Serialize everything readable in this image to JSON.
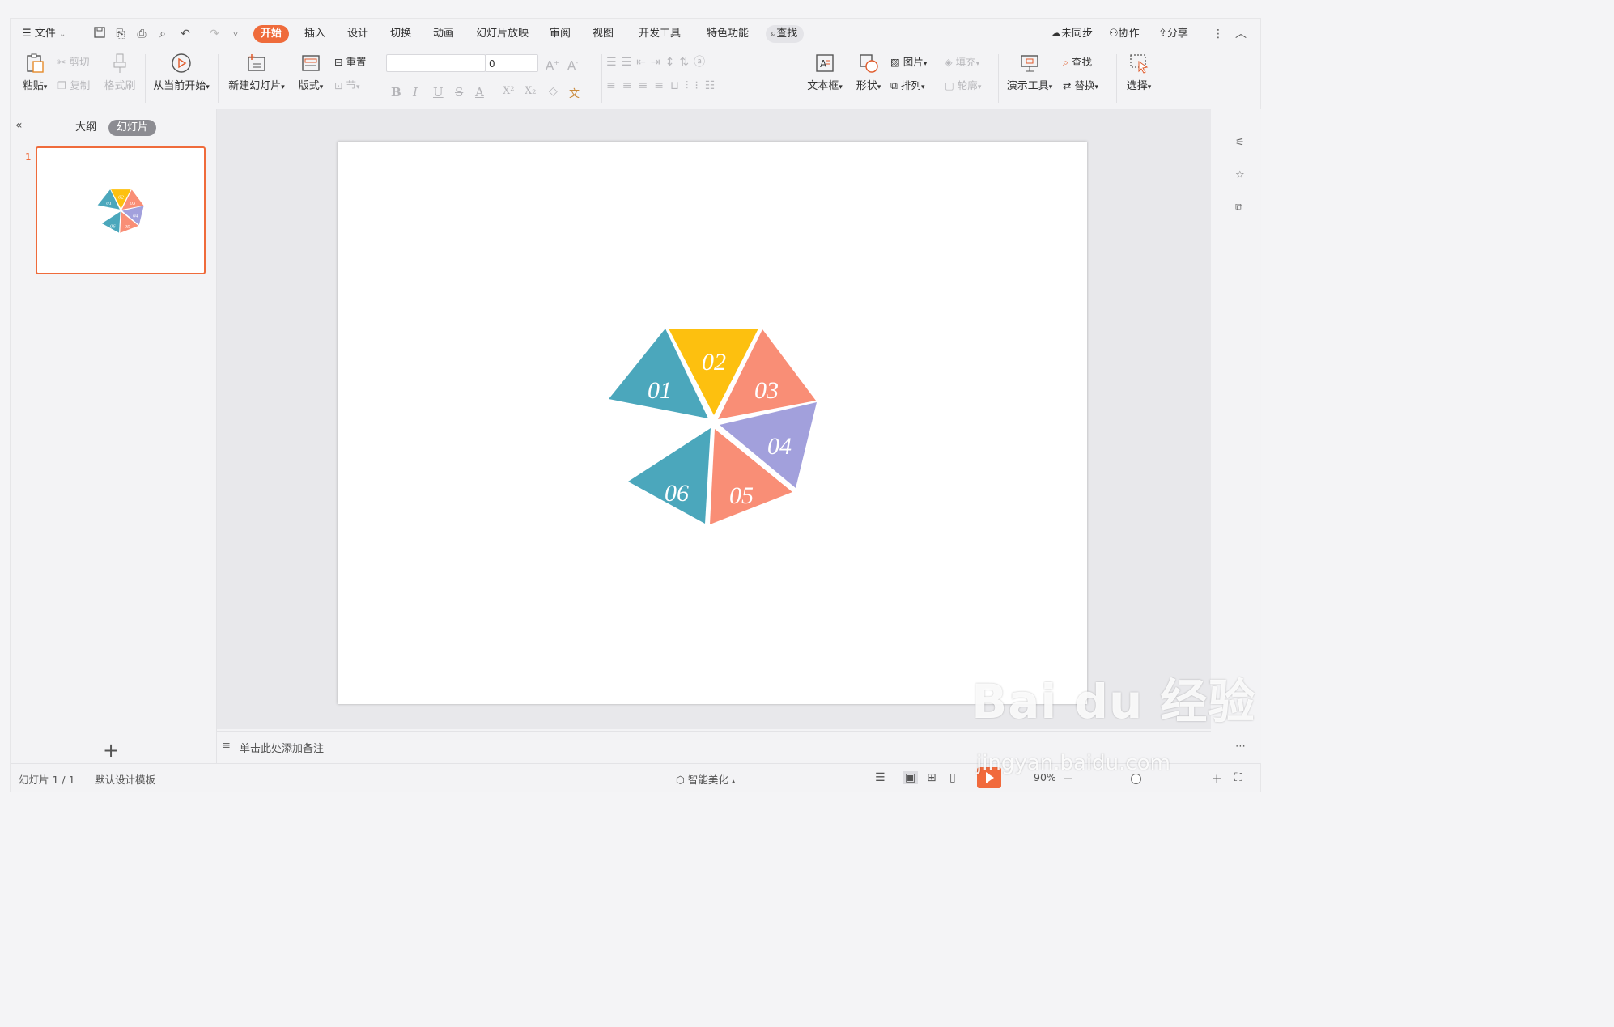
{
  "menu": {
    "file_label": "文件",
    "tabs": [
      "开始",
      "插入",
      "设计",
      "切换",
      "动画",
      "幻灯片放映",
      "审阅",
      "视图",
      "开发工具",
      "特色功能"
    ],
    "search_label": "查找",
    "sync_label": "未同步",
    "collab_label": "协作",
    "share_label": "分享"
  },
  "ribbon": {
    "paste": "粘贴",
    "cut": "剪切",
    "copy": "复制",
    "format_painter": "格式刷",
    "play_from_current": "从当前开始",
    "new_slide": "新建幻灯片",
    "layout": "版式",
    "reset": "重置",
    "section": "节",
    "font_name_value": "",
    "font_size_value": "0",
    "text_box": "文本框",
    "shape": "形状",
    "picture": "图片",
    "fill": "填充",
    "arrange": "排列",
    "outline": "轮廓",
    "presenter_tools": "演示工具",
    "find": "查找",
    "replace": "替换",
    "select": "选择"
  },
  "left_panel": {
    "tab_outline": "大纲",
    "tab_slides": "幻灯片",
    "slide_number": "1",
    "add_label": "+"
  },
  "slide": {
    "segments": [
      {
        "label": "01",
        "color": "#4ba7bc"
      },
      {
        "label": "02",
        "color": "#fdc00f"
      },
      {
        "label": "03",
        "color": "#f98e76"
      },
      {
        "label": "04",
        "color": "#a2a0dc"
      },
      {
        "label": "05",
        "color": "#f98e76"
      },
      {
        "label": "06",
        "color": "#4ba7bc"
      }
    ]
  },
  "notes_placeholder": "单击此处添加备注",
  "status": {
    "slide_counter": "幻灯片 1 / 1",
    "template": "默认设计模板",
    "smart_beautify": "智能美化",
    "zoom": "90%"
  },
  "watermark": {
    "brand": "Bai du 经验",
    "url": "jingyan.baidu.com"
  },
  "accent_color": "#ef6b3b"
}
